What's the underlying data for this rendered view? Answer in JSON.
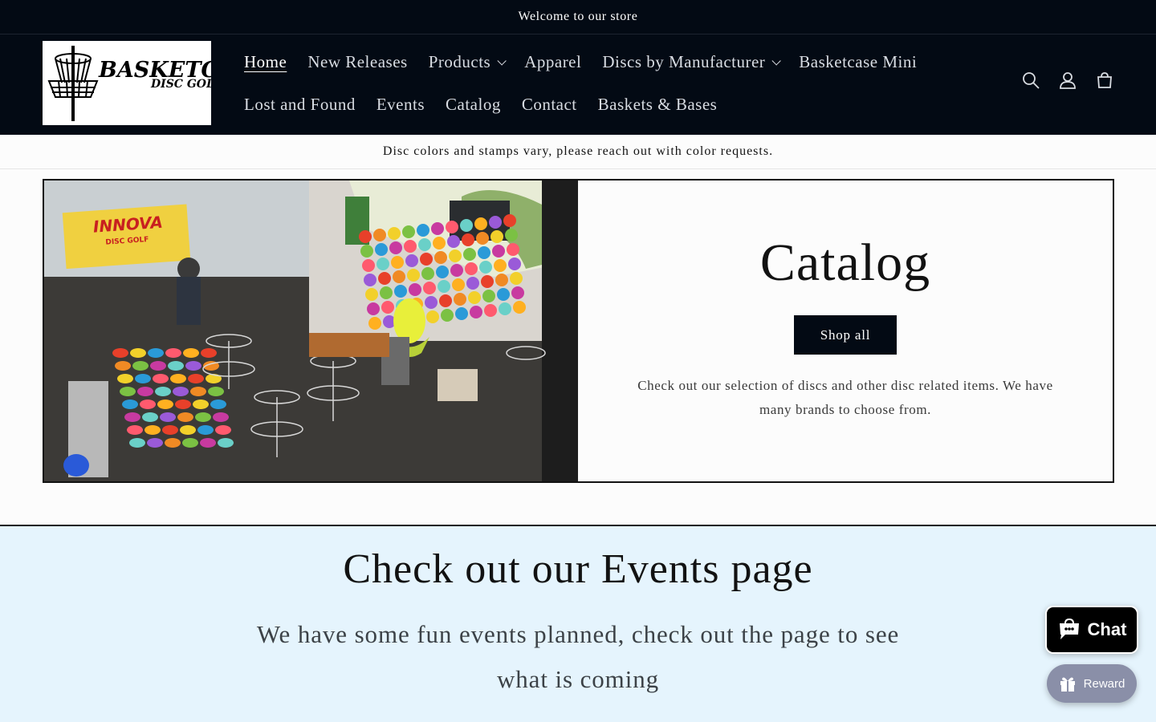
{
  "announcement": {
    "text": "Welcome to our store"
  },
  "logo": {
    "brand": "BASKETCASE",
    "sub": "DISC GOLF"
  },
  "nav": {
    "items": [
      {
        "label": "Home",
        "active": true,
        "dropdown": false
      },
      {
        "label": "New Releases",
        "active": false,
        "dropdown": false
      },
      {
        "label": "Products",
        "active": false,
        "dropdown": true
      },
      {
        "label": "Apparel",
        "active": false,
        "dropdown": false
      },
      {
        "label": "Discs by Manufacturer",
        "active": false,
        "dropdown": true
      },
      {
        "label": "Basketcase Mini",
        "active": false,
        "dropdown": false
      },
      {
        "label": "Lost and Found",
        "active": false,
        "dropdown": false
      },
      {
        "label": "Events",
        "active": false,
        "dropdown": false
      },
      {
        "label": "Catalog",
        "active": false,
        "dropdown": false
      },
      {
        "label": "Contact",
        "active": false,
        "dropdown": false
      },
      {
        "label": "Baskets & Bases",
        "active": false,
        "dropdown": false
      }
    ]
  },
  "header_icons": [
    "search-icon",
    "account-icon",
    "cart-icon"
  ],
  "notice": {
    "text": "Disc colors and stamps vary, please reach out with color requests."
  },
  "banner": {
    "photo_sign": "INNOVA",
    "photo_sign_sub": "DISC GOLF",
    "title": "Catalog",
    "button_label": "Shop all",
    "description": "Check out our selection of discs and other disc related items. We have many brands to choose from."
  },
  "events": {
    "title": "Check out our Events page",
    "text": "We have some fun events planned, check out the page to see what is coming"
  },
  "chat": {
    "label": "Chat"
  },
  "reward": {
    "label": "Reward"
  },
  "colors": {
    "header_bg": "#030a14",
    "events_bg": "#e5f4fd",
    "chat_bg": "#000000",
    "reward_bg": "#8a8fa8"
  }
}
